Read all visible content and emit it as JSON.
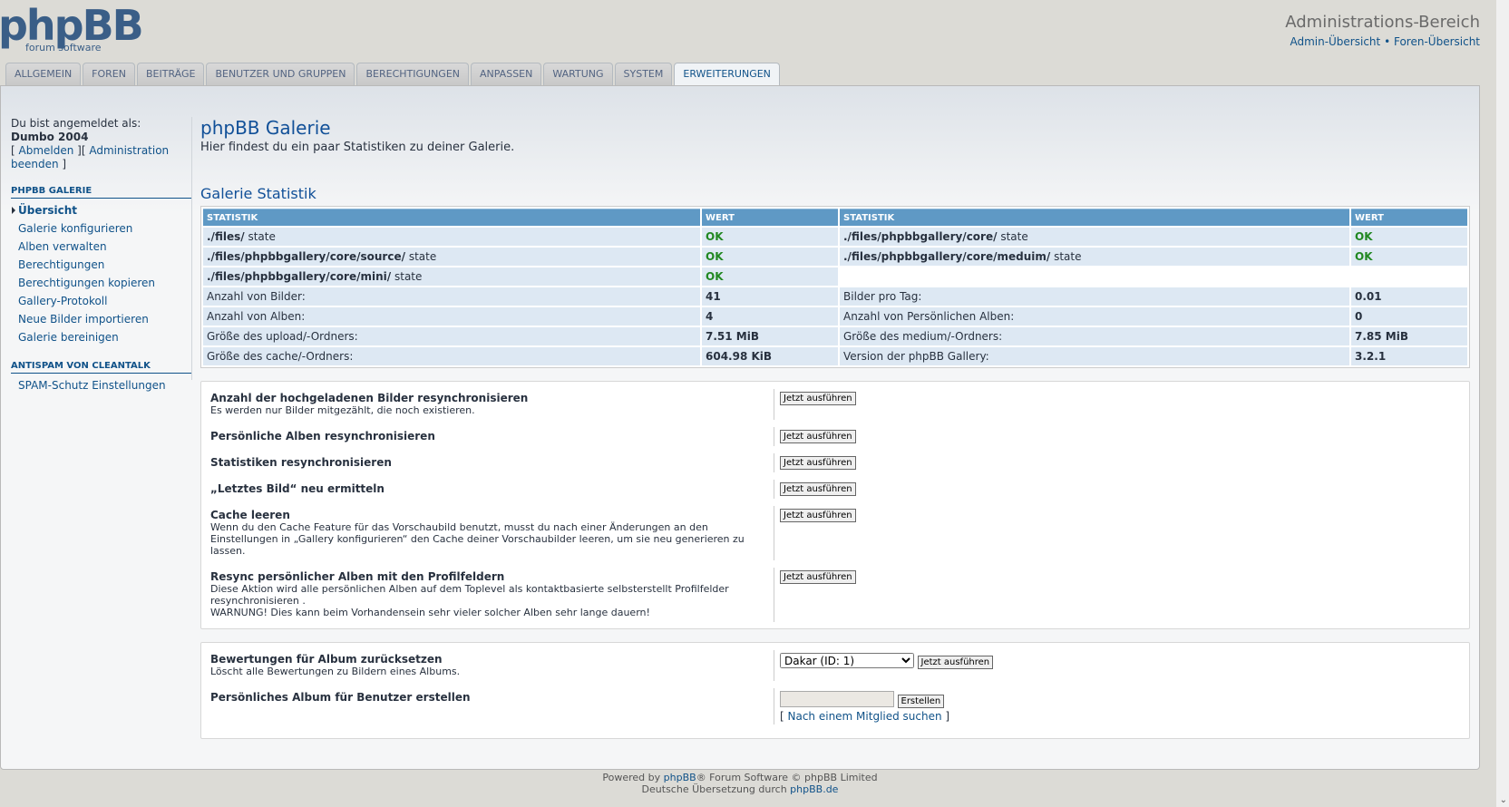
{
  "header": {
    "logo_text": "phpBB",
    "logo_subtext": "forum software",
    "admin_title": "Administrations-Bereich",
    "link_admin": "Admin-Übersicht",
    "link_sep": "•",
    "link_forum": "Foren-Übersicht"
  },
  "tabs": [
    {
      "label": "Allgemein"
    },
    {
      "label": "Foren"
    },
    {
      "label": "Beiträge"
    },
    {
      "label": "Benutzer und Gruppen"
    },
    {
      "label": "Berechtigungen"
    },
    {
      "label": "Anpassen"
    },
    {
      "label": "Wartung"
    },
    {
      "label": "System"
    },
    {
      "label": "Erweiterungen"
    }
  ],
  "sidebar": {
    "logged_in_label": "Du bist angemeldet als:",
    "username": "Dumbo 2004",
    "logout": "Abmelden",
    "end_admin": "Administration beenden",
    "section1": "phpBB Galerie",
    "items1": [
      {
        "label": "Übersicht"
      },
      {
        "label": "Galerie konfigurieren"
      },
      {
        "label": "Alben verwalten"
      },
      {
        "label": "Berechtigungen"
      },
      {
        "label": "Berechtigungen kopieren"
      },
      {
        "label": "Gallery-Protokoll"
      },
      {
        "label": "Neue Bilder importieren"
      },
      {
        "label": "Galerie bereinigen"
      }
    ],
    "section2": "Antispam von CleanTalk",
    "items2": [
      {
        "label": "SPAM-Schutz Einstellungen"
      }
    ]
  },
  "main": {
    "title": "phpBB Galerie",
    "intro": "Hier findest du ein paar Statistiken zu deiner Galerie.",
    "stats_title": "Galerie Statistik",
    "stats_headers": [
      "Statistik",
      "Wert",
      "Statistik",
      "Wert"
    ],
    "state_word": "state",
    "rows": [
      {
        "k1": "./files/",
        "v1": "OK",
        "k2": "./files/phpbbgallery/core/",
        "v2": "OK"
      },
      {
        "k1": "./files/phpbbgallery/core/source/",
        "v1": "OK",
        "k2": "./files/phpbbgallery/core/meduim/",
        "v2": "OK"
      },
      {
        "k1": "./files/phpbbgallery/core/mini/",
        "v1": "OK"
      }
    ],
    "num_rows": [
      {
        "k1": "Anzahl von Bilder:",
        "v1": "41",
        "k2": "Bilder pro Tag:",
        "v2": "0.01"
      },
      {
        "k1": "Anzahl von Alben:",
        "v1": "4",
        "k2": "Anzahl von Persönlichen Alben:",
        "v2": "0"
      },
      {
        "k1": "Größe des upload/-Ordners:",
        "v1": "7.51 MiB",
        "k2": "Größe des medium/-Ordners:",
        "v2": "7.85 MiB"
      },
      {
        "k1": "Größe des cache/-Ordners:",
        "v1": "604.98 KiB",
        "k2": "Version der phpBB Gallery:",
        "v2": "3.2.1"
      }
    ],
    "run_label": "Jetzt ausführen",
    "actions": [
      {
        "title": "Anzahl der hochgeladenen Bilder resynchronisieren",
        "desc": "Es werden nur Bilder mitgezählt, die noch existieren."
      },
      {
        "title": "Persönliche Alben resynchronisieren",
        "desc": ""
      },
      {
        "title": "Statistiken resynchronisieren",
        "desc": ""
      },
      {
        "title": "„Letztes Bild“ neu ermitteln",
        "desc": ""
      },
      {
        "title": "Cache leeren",
        "desc": "Wenn du den Cache Feature für das Vorschaubild benutzt, musst du nach einer Änderungen an den Einstellungen in „Gallery konfigurieren“ den Cache deiner Vorschaubilder leeren, um sie neu generieren zu lassen."
      },
      {
        "title": "Resync persönlicher Alben mit den Profilfeldern",
        "desc": "Diese Aktion wird alle persönlichen Alben auf dem Toplevel als kontaktbasierte selbsterstellt Profilfelder resynchronisieren .",
        "desc2": "WARNUNG! Dies kann beim Vorhandensein sehr vieler solcher Alben sehr lange dauern!"
      }
    ],
    "reset_title": "Bewertungen für Album zurücksetzen",
    "reset_desc": "Löscht alle Bewertungen zu Bildern eines Albums.",
    "album_select": "Dakar (ID: 1)",
    "create_title": "Persönliches Album für Benutzer erstellen",
    "create_button": "Erstellen",
    "find_member": "Nach einem Mitglied suchen"
  },
  "footer": {
    "line1_pre": "Powered by",
    "line1_link": "phpBB",
    "line1_post": "® Forum Software © phpBB Limited",
    "line2_pre": "Deutsche Übersetzung durch",
    "line2_link": "phpBB.de"
  }
}
